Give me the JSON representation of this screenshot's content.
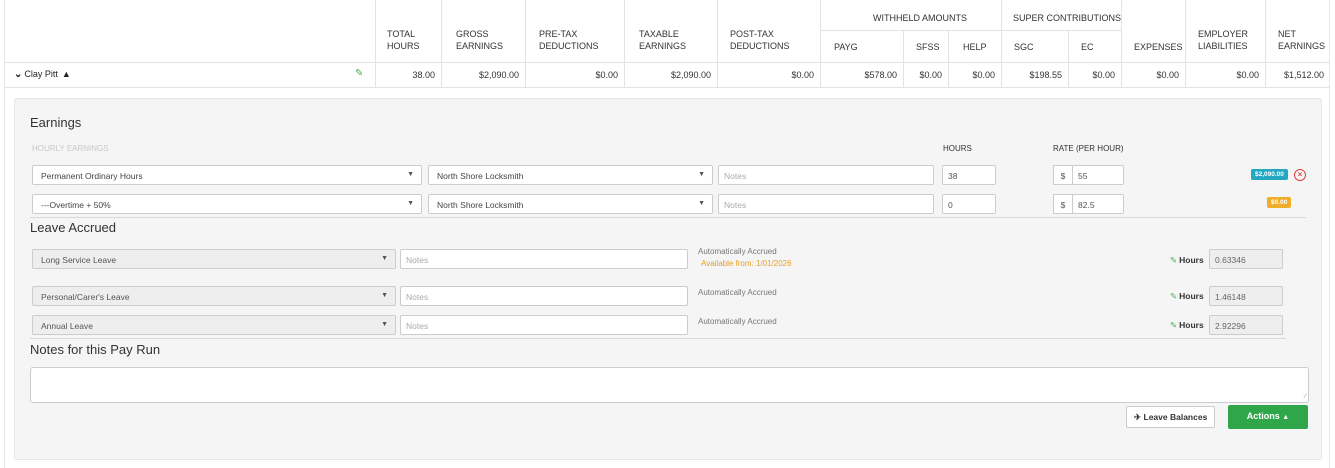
{
  "header": {
    "total_hours": [
      "TOTAL",
      "HOURS"
    ],
    "gross_earnings": [
      "GROSS",
      "EARNINGS"
    ],
    "pre_tax": [
      "PRE-TAX",
      "DEDUCTIONS"
    ],
    "taxable": [
      "TAXABLE",
      "EARNINGS"
    ],
    "post_tax": [
      "POST-TAX",
      "DEDUCTIONS"
    ],
    "withheld_group": "WITHHELD AMOUNTS",
    "payg": "PAYG",
    "sfss": "SFSS",
    "help": "HELP",
    "super_group": "SUPER CONTRIBUTIONS",
    "sgc": "SGC",
    "ec": "EC",
    "expenses": "EXPENSES",
    "employer_liab": [
      "EMPLOYER",
      "LIABILITIES"
    ],
    "net_earnings": [
      "NET",
      "EARNINGS"
    ]
  },
  "employee": {
    "name": "Clay Pitt",
    "chevron": "⌄",
    "warning": "▲",
    "values": {
      "total_hours": "38.00",
      "gross": "$2,090.00",
      "pre_tax": "$0.00",
      "taxable": "$2,090.00",
      "post_tax": "$0.00",
      "payg": "$578.00",
      "sfss": "$0.00",
      "help": "$0.00",
      "sgc": "$198.55",
      "ec": "$0.00",
      "expenses": "$0.00",
      "employer_liab": "$0.00",
      "net": "$1,512.00"
    }
  },
  "earnings": {
    "title": "Earnings",
    "subheading": "HOURLY EARNINGS",
    "hours_header": "HOURS",
    "rate_header": "RATE (PER HOUR)",
    "rows": [
      {
        "pay_category": "Permanent Ordinary Hours",
        "location": "North Shore Locksmith",
        "notes_placeholder": "Notes",
        "hours": "38",
        "currency": "$",
        "rate": "55",
        "amount": "$2,090.00"
      },
      {
        "pay_category": "---Overtime + 50%",
        "location": "North Shore Locksmith",
        "notes_placeholder": "Notes",
        "hours": "0",
        "currency": "$",
        "rate": "82.5",
        "amount": "$0.00"
      }
    ]
  },
  "leave": {
    "title": "Leave Accrued",
    "hours_label": "Hours",
    "rows": [
      {
        "type": "Long Service Leave",
        "notes_placeholder": "Notes",
        "status": "Automatically Accrued",
        "available": "Available from: 1/01/2026",
        "hours": "0.63346"
      },
      {
        "type": "Personal/Carer's Leave",
        "notes_placeholder": "Notes",
        "status": "Automatically Accrued",
        "available": "",
        "hours": "1.46148"
      },
      {
        "type": "Annual Leave",
        "notes_placeholder": "Notes",
        "status": "Automatically Accrued",
        "available": "",
        "hours": "2.92296"
      }
    ]
  },
  "notes": {
    "title": "Notes for this Pay Run",
    "value": ""
  },
  "buttons": {
    "leave_balances": "Leave Balances",
    "actions": "Actions"
  },
  "icons": {
    "pencil": "pencil-icon",
    "warning": "warning-icon",
    "remove": "remove-circle-icon",
    "plane": "plane-icon"
  },
  "colors": {
    "green": "#2fa64a",
    "teal_badge": "#23a7c2",
    "amber_badge": "#f0ad2a",
    "remove_red": "#e04040",
    "available_text": "#e6a02a"
  }
}
